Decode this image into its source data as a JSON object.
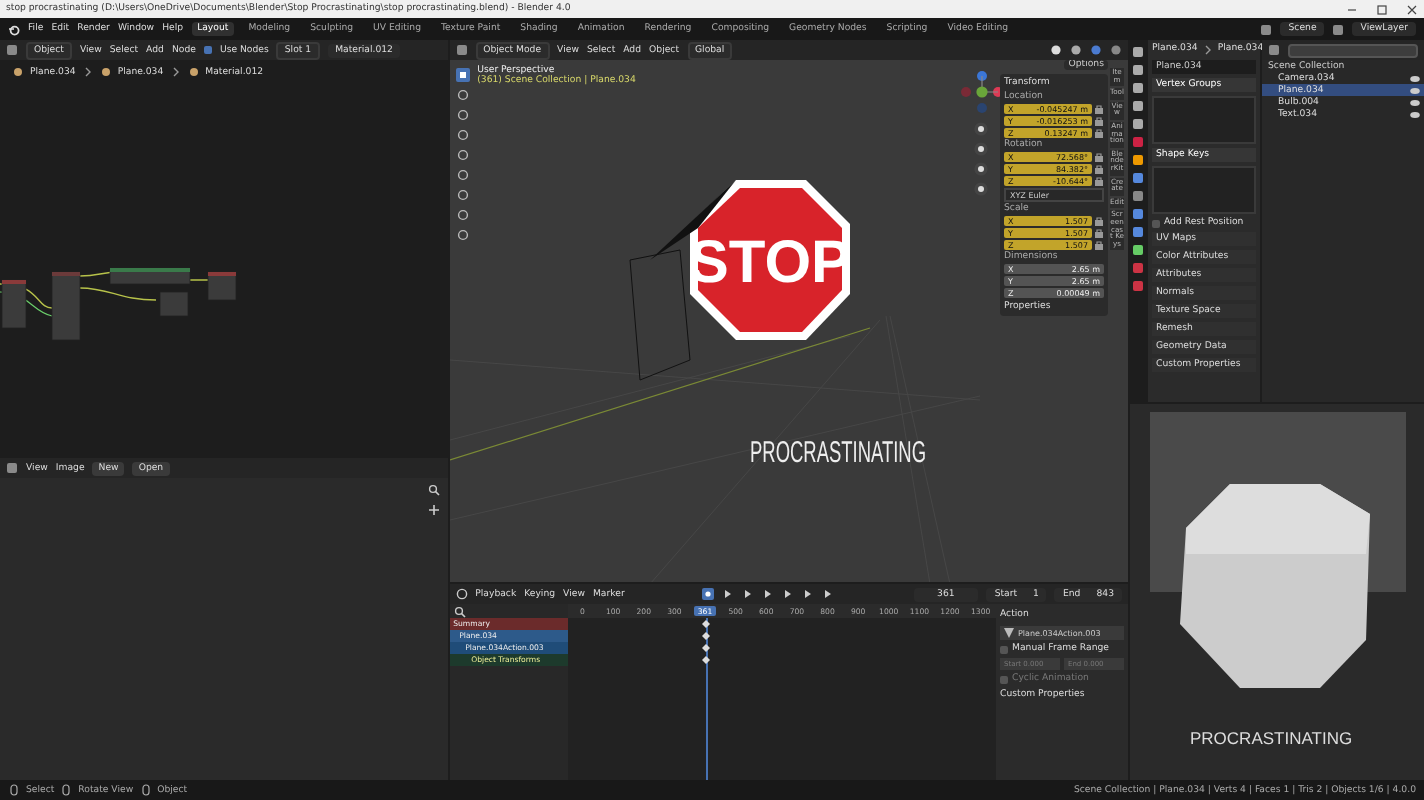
{
  "window": {
    "title": "stop procrastinating (D:\\Users\\OneDrive\\Documents\\Blender\\Stop Procrastinating\\stop procrastinating.blend) - Blender 4.0"
  },
  "menu": [
    "File",
    "Edit",
    "Render",
    "Window",
    "Help"
  ],
  "workspaces": [
    {
      "label": "Layout",
      "selected": true
    },
    {
      "label": "Modeling",
      "selected": false
    },
    {
      "label": "Sculpting",
      "selected": false
    },
    {
      "label": "UV Editing",
      "selected": false
    },
    {
      "label": "Texture Paint",
      "selected": false
    },
    {
      "label": "Shading",
      "selected": false
    },
    {
      "label": "Animation",
      "selected": false
    },
    {
      "label": "Rendering",
      "selected": false
    },
    {
      "label": "Compositing",
      "selected": false
    },
    {
      "label": "Geometry Nodes",
      "selected": false
    },
    {
      "label": "Scripting",
      "selected": false
    },
    {
      "label": "Video Editing",
      "selected": false
    }
  ],
  "scene": "Scene",
  "view_layer": "ViewLayer",
  "node_editor": {
    "header": [
      {
        "kind": "dropdown",
        "label": "Object"
      },
      {
        "kind": "menu",
        "label": "View"
      },
      {
        "kind": "menu",
        "label": "Select"
      },
      {
        "kind": "menu",
        "label": "Add"
      },
      {
        "kind": "menu",
        "label": "Node"
      },
      {
        "kind": "checkbox",
        "label": "Use Nodes",
        "checked": true
      },
      {
        "kind": "dropdown",
        "label": "Slot 1"
      },
      {
        "kind": "field",
        "label": "Material.012"
      }
    ],
    "breadcrumbs": [
      "Plane.034",
      "Plane.034",
      "Material.012"
    ]
  },
  "image_editor": {
    "header": [
      {
        "kind": "menu",
        "label": "View"
      },
      {
        "kind": "menu",
        "label": "Image"
      },
      {
        "kind": "button",
        "label": "New"
      },
      {
        "kind": "button",
        "label": "Open"
      }
    ]
  },
  "viewport": {
    "header": [
      {
        "kind": "dropdown",
        "label": "Object Mode"
      },
      {
        "kind": "menu",
        "label": "View"
      },
      {
        "kind": "menu",
        "label": "Select"
      },
      {
        "kind": "menu",
        "label": "Add"
      },
      {
        "kind": "menu",
        "label": "Object"
      },
      {
        "kind": "dropdown",
        "label": "Global"
      }
    ],
    "view_name": "User Perspective",
    "context": "(361) Scene Collection | Plane.034",
    "options": "Options",
    "sign_text": "STOP",
    "caption": "PROCRASTINATING"
  },
  "sidebar": {
    "tabs": [
      "Item",
      "Tool",
      "View",
      "Animation",
      "BlenderKit",
      "Create",
      "Edit",
      "Screencast Keys"
    ],
    "title": "Transform",
    "groups": [
      {
        "label": "Location",
        "animated": true,
        "rows": [
          {
            "axis": "X",
            "value": "-0.045247 m"
          },
          {
            "axis": "Y",
            "value": "-0.016253 m"
          },
          {
            "axis": "Z",
            "value": "0.13247 m"
          }
        ]
      },
      {
        "label": "Rotation",
        "animated": true,
        "rows": [
          {
            "axis": "X",
            "value": "72.568°"
          },
          {
            "axis": "Y",
            "value": "84.382°"
          },
          {
            "axis": "Z",
            "value": "-10.644°"
          }
        ],
        "mode": "XYZ Euler"
      },
      {
        "label": "Scale",
        "animated": true,
        "rows": [
          {
            "axis": "X",
            "value": "1.507"
          },
          {
            "axis": "Y",
            "value": "1.507"
          },
          {
            "axis": "Z",
            "value": "1.507"
          }
        ]
      },
      {
        "label": "Dimensions",
        "animated": false,
        "rows": [
          {
            "axis": "X",
            "value": "2.65 m"
          },
          {
            "axis": "Y",
            "value": "2.65 m"
          },
          {
            "axis": "Z",
            "value": "0.00049 m"
          }
        ]
      }
    ],
    "footer": "Properties"
  },
  "properties": {
    "breadcrumbs": [
      "Plane.034",
      "Plane.034"
    ],
    "mesh": "Plane.034",
    "panels": [
      {
        "kind": "list",
        "label": "Vertex Groups",
        "expanded": true
      },
      {
        "kind": "list",
        "label": "Shape Keys",
        "expanded": true
      },
      {
        "kind": "checkbox",
        "label": "Add Rest Position",
        "checked": false
      },
      {
        "kind": "panel",
        "label": "UV Maps",
        "expanded": false
      },
      {
        "kind": "panel",
        "label": "Color Attributes",
        "expanded": false
      },
      {
        "kind": "panel",
        "label": "Attributes",
        "expanded": false
      },
      {
        "kind": "panel",
        "label": "Normals",
        "expanded": false
      },
      {
        "kind": "panel",
        "label": "Texture Space",
        "expanded": false
      },
      {
        "kind": "panel",
        "label": "Remesh",
        "expanded": false
      },
      {
        "kind": "panel",
        "label": "Geometry Data",
        "expanded": false
      },
      {
        "kind": "panel",
        "label": "Custom Properties",
        "expanded": false
      }
    ]
  },
  "outliner": {
    "root": "Scene Collection",
    "items": [
      {
        "label": "Camera.034",
        "selected": false
      },
      {
        "label": "Plane.034",
        "selected": true
      },
      {
        "label": "Bulb.004",
        "selected": false
      },
      {
        "label": "Text.034",
        "selected": false
      }
    ]
  },
  "timeline": {
    "header": [
      {
        "kind": "menu",
        "label": "Playback"
      },
      {
        "kind": "menu",
        "label": "Keying"
      },
      {
        "kind": "menu",
        "label": "View"
      },
      {
        "kind": "menu",
        "label": "Marker"
      }
    ],
    "current": "361",
    "start_label": "Start",
    "start": "1",
    "end_label": "End",
    "end": "843",
    "ticks": [
      {
        "kind": "tick",
        "label": "0"
      },
      {
        "kind": "tick",
        "label": "100"
      },
      {
        "kind": "tick",
        "label": "200"
      },
      {
        "kind": "tick",
        "label": "300"
      },
      {
        "kind": "current",
        "label": "361"
      },
      {
        "kind": "tick",
        "label": "500"
      },
      {
        "kind": "tick",
        "label": "600"
      },
      {
        "kind": "tick",
        "label": "700"
      },
      {
        "kind": "tick",
        "label": "800"
      },
      {
        "kind": "tick",
        "label": "900"
      },
      {
        "kind": "tick",
        "label": "1000"
      },
      {
        "kind": "tick",
        "label": "1100"
      },
      {
        "kind": "tick",
        "label": "1200"
      },
      {
        "kind": "tick",
        "label": "1300"
      }
    ],
    "channels": [
      {
        "kind": "summary",
        "label": "Summary",
        "children": [
          {
            "kind": "object",
            "label": "Plane.034",
            "children": [
              {
                "kind": "action",
                "label": "Plane.034Action.003",
                "children": [
                  {
                    "kind": "group",
                    "label": "Object Transforms"
                  }
                ]
              }
            ]
          }
        ]
      }
    ],
    "action": {
      "title": "Action",
      "name": "Plane.034Action.003",
      "manual_range": "Manual Frame Range",
      "manual_checked": false,
      "start": "Start  0.000",
      "end": "End  0.000",
      "cyclic": "Cyclic Animation",
      "cyclic_checked": false,
      "custom": "Custom Properties"
    }
  },
  "render": {
    "caption": "PROCRASTINATING"
  },
  "status": {
    "left": [
      "Select",
      "Rotate View",
      "Object"
    ],
    "right": "Scene Collection | Plane.034 | Verts 4 | Faces 1 | Tris 2 | Objects 1/6 | 4.0.0"
  }
}
